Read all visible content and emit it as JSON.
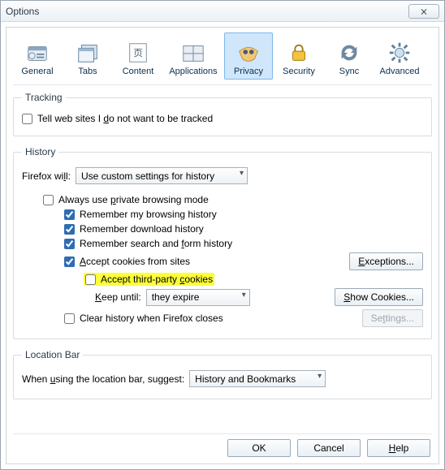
{
  "window": {
    "title": "Options",
    "close_glyph": "⨯"
  },
  "tabs": [
    {
      "id": "general",
      "label": "General"
    },
    {
      "id": "tabs",
      "label": "Tabs"
    },
    {
      "id": "content",
      "label": "Content"
    },
    {
      "id": "applications",
      "label": "Applications"
    },
    {
      "id": "privacy",
      "label": "Privacy"
    },
    {
      "id": "security",
      "label": "Security"
    },
    {
      "id": "sync",
      "label": "Sync"
    },
    {
      "id": "advanced",
      "label": "Advanced"
    }
  ],
  "selected_tab": "privacy",
  "tracking": {
    "legend": "Tracking",
    "dnt_pre": "Tell web sites I ",
    "dnt_mn": "d",
    "dnt_post": "o not want to be tracked",
    "dnt_checked": false
  },
  "history": {
    "legend": "History",
    "firefox_will_pre": "Firefox wi",
    "firefox_will_mn": "l",
    "firefox_will_post": "l:",
    "mode": "Use custom settings for history",
    "always_private": {
      "pre": "Always use ",
      "mn": "p",
      "post": "rivate browsing mode",
      "checked": false
    },
    "remember_browsing": {
      "text": "Remember my browsing history",
      "checked": true
    },
    "remember_downloads": {
      "text": "Remember download history",
      "checked": true
    },
    "remember_forms": {
      "pre": "Remember search and ",
      "mn": "f",
      "post": "orm history",
      "checked": true
    },
    "accept_cookies": {
      "mn": "A",
      "post": "ccept cookies from sites",
      "checked": true
    },
    "exceptions_btn": {
      "mn": "E",
      "post": "xceptions..."
    },
    "accept_third": {
      "pre": "Accept third-party ",
      "mn": "c",
      "post": "ookies",
      "checked": false
    },
    "keep_until_label": {
      "mn": "K",
      "post": "eep until:"
    },
    "keep_until_value": "they expire",
    "show_cookies_btn": {
      "mn": "S",
      "post": "how Cookies..."
    },
    "clear_on_close": {
      "pre": "Clear history when Firefox closes",
      "checked": false
    },
    "settings_btn": {
      "pre": "Se",
      "mn": "t",
      "post": "tings...",
      "disabled": true
    }
  },
  "locationbar": {
    "legend": "Location Bar",
    "label": {
      "pre": "When ",
      "mn": "u",
      "post": "sing the location bar, suggest:"
    },
    "value": "History and Bookmarks"
  },
  "footer": {
    "ok": "OK",
    "cancel": "Cancel",
    "help_mn": "H",
    "help_post": "elp"
  }
}
